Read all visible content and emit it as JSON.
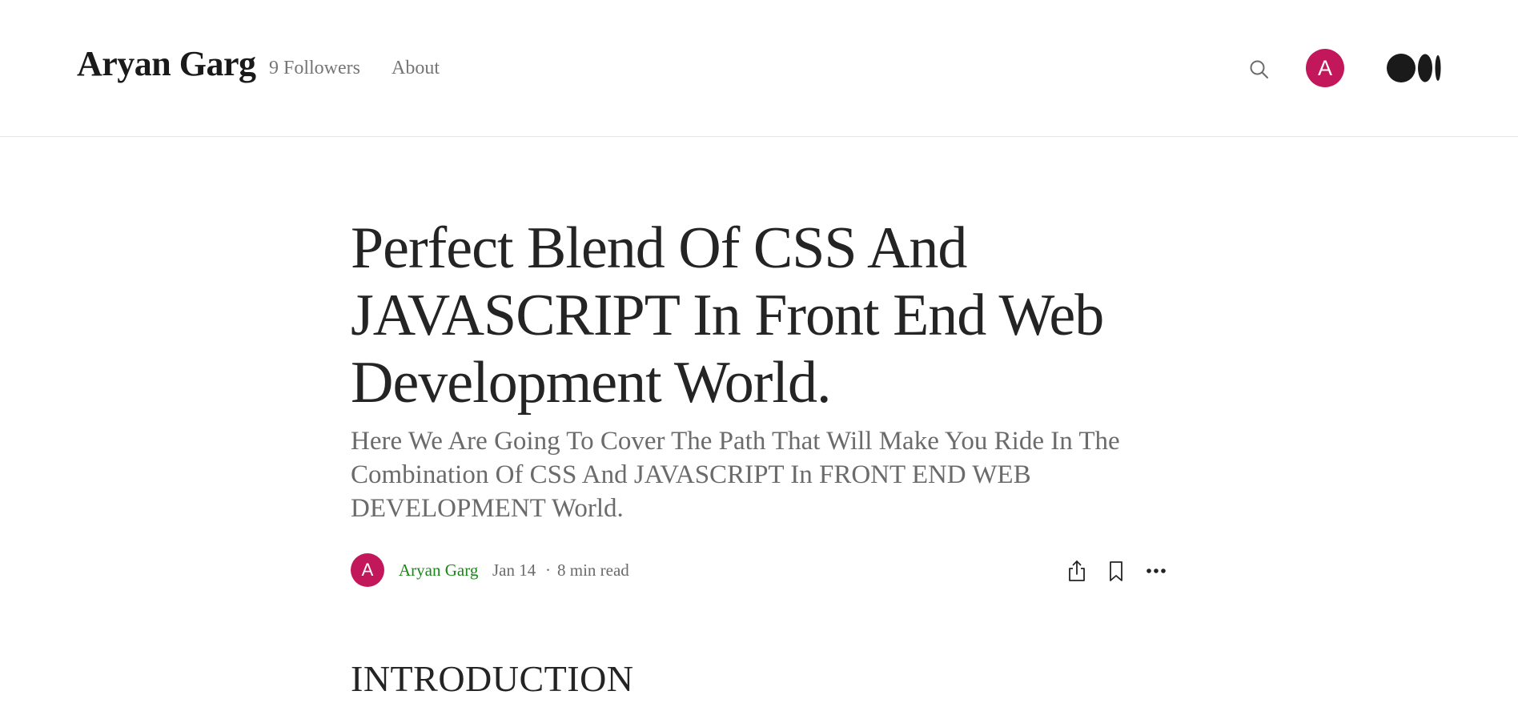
{
  "header": {
    "brand": "Aryan Garg",
    "followers_label": "9 Followers",
    "about_label": "About",
    "avatar_letter": "A",
    "icons": {
      "search": "search-icon",
      "logo": "medium-logo-icon"
    },
    "avatar_color": "#c2185b"
  },
  "article": {
    "title": "Perfect Blend Of CSS And JAVASCRIPT In Front End Web Development World.",
    "subtitle": "Here We Are Going To Cover The Path That Will Make You Ride In The Combination Of CSS And JAVASCRIPT In FRONT END WEB DEVELOPMENT World.",
    "byline": {
      "avatar_letter": "A",
      "author": "Aryan Garg",
      "date": "Jan 14",
      "separator": "·",
      "read_time": "8 min read"
    },
    "actions": {
      "share": "share-icon",
      "bookmark": "bookmark-icon",
      "more": "more-icon"
    },
    "first_heading": "INTRODUCTION"
  },
  "colors": {
    "author_link": "#1a8917",
    "muted_text": "#6b6b6b",
    "text": "#242424"
  }
}
